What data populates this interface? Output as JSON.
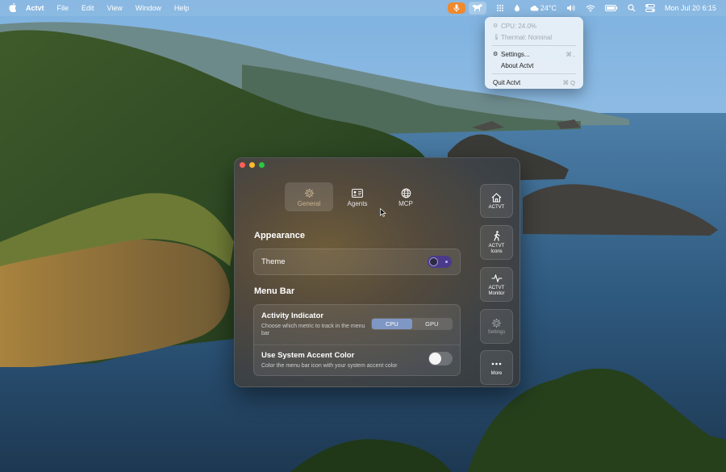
{
  "menubar": {
    "app_name": "Actvt",
    "menus": [
      "File",
      "Edit",
      "View",
      "Window",
      "Help"
    ],
    "weather": "24°C",
    "datetime": "Mon Jul 20  6:15"
  },
  "dropdown": {
    "cpu": "CPU: 24.0%",
    "thermal": "Thermal: Nominal",
    "settings": "Settings...",
    "settings_shortcut": "⌘ ,",
    "about": "About Actvt",
    "quit": "Quit Actvt",
    "quit_shortcut": "⌘ Q"
  },
  "window": {
    "tabs": [
      {
        "label": "General",
        "icon": "gear-icon",
        "active": true
      },
      {
        "label": "Agents",
        "icon": "id-card-icon",
        "active": false
      },
      {
        "label": "MCP",
        "icon": "globe-icon",
        "active": false
      }
    ],
    "appearance": {
      "heading": "Appearance",
      "theme_label": "Theme"
    },
    "menu_bar": {
      "heading": "Menu Bar",
      "activity_title": "Activity Indicator",
      "activity_desc": "Choose which metric to track in the menu bar",
      "options": [
        "CPU",
        "GPU"
      ],
      "selected": "CPU",
      "accent_title": "Use System Accent Color",
      "accent_desc": "Color the menu bar icon with your system accent color",
      "accent_enabled": false
    }
  },
  "sidebar": {
    "items": [
      {
        "label": "ACTVT",
        "icon": "home-icon"
      },
      {
        "label": "ACTVT\nIcons",
        "icon": "walking-figure-icon"
      },
      {
        "label": "ACTVT\nMonitor",
        "icon": "pulse-icon"
      },
      {
        "label": "Settings",
        "icon": "gear-icon"
      },
      {
        "label": "More",
        "icon": "ellipsis-icon"
      }
    ]
  },
  "colors": {
    "segment_selected": "#7f97c4",
    "menubar_mic": "#f08a2e"
  }
}
